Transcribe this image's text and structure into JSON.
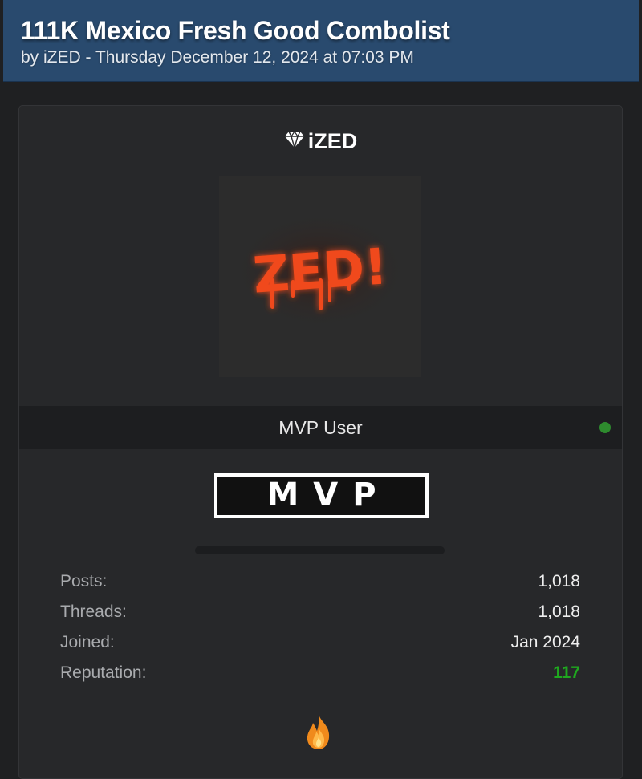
{
  "thread": {
    "title": "111K Mexico Fresh Good Combolist",
    "meta": "by iZED - Thursday December 12, 2024 at 07:03 PM"
  },
  "user": {
    "username": "iZED",
    "username_icon": "diamond-icon",
    "avatar_text": "ZED!",
    "rank": "MVP User",
    "status_color": "#2e8b2e",
    "badge": "MVP",
    "stats": [
      {
        "label": "Posts:",
        "value": "1,018"
      },
      {
        "label": "Threads:",
        "value": "1,018"
      },
      {
        "label": "Joined:",
        "value": "Jan 2024"
      },
      {
        "label": "Reputation:",
        "value": "117"
      }
    ],
    "award_icon": "fire-icon"
  },
  "colors": {
    "header_bg": "#294a6e",
    "page_bg": "#1f2022",
    "card_bg": "#27282a",
    "reputation": "#1fa81f"
  }
}
